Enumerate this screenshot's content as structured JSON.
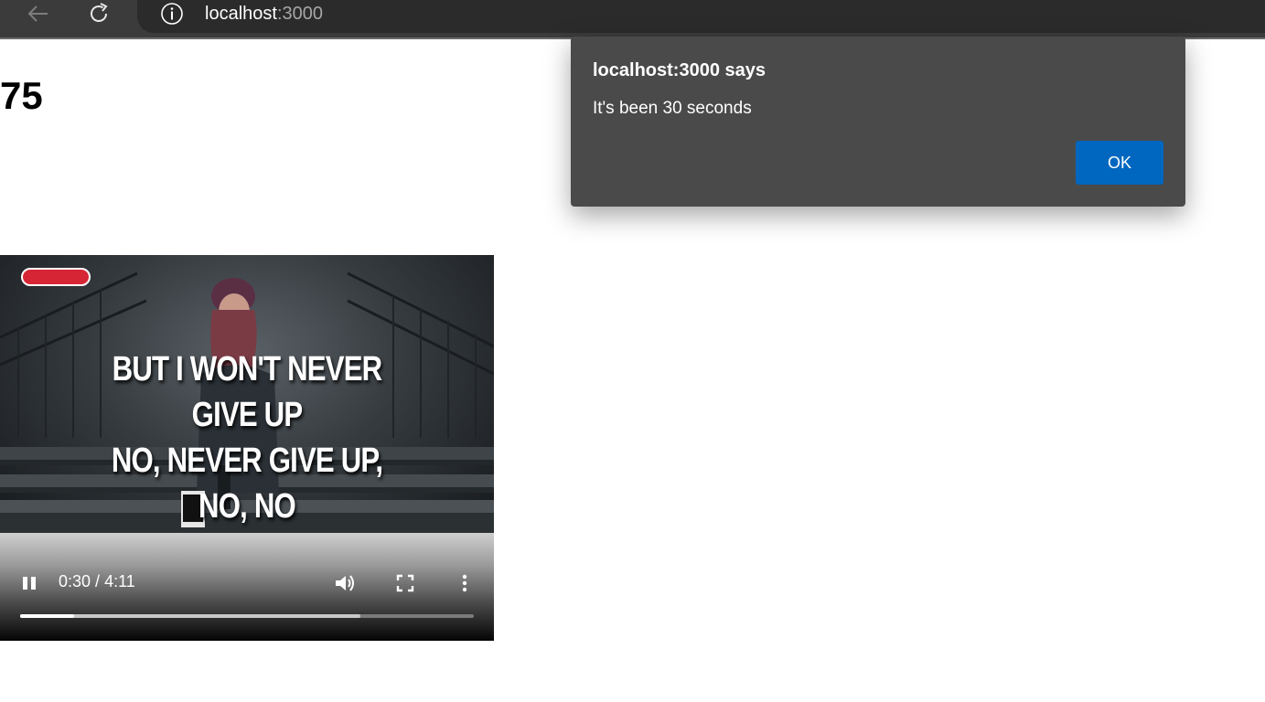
{
  "browser": {
    "url_host": "localhost",
    "url_port": ":3000",
    "back_icon": "back-arrow-icon",
    "reload_icon": "reload-icon",
    "site_info_icon": "info-icon"
  },
  "page": {
    "counter": "75"
  },
  "video": {
    "lyrics_line1": "BUT I WON'T NEVER GIVE UP",
    "lyrics_line2": "NO, NEVER GIVE UP, NO, NO",
    "current_time": "0:30",
    "time_separator": " / ",
    "duration": "4:11",
    "played_fraction": 0.1195,
    "buffered_fraction": 0.75,
    "badge_color": "#d62636"
  },
  "dialog": {
    "title": "localhost:3000 says",
    "message": "It's been 30 seconds",
    "ok_label": "OK",
    "ok_color": "#0067c0"
  }
}
